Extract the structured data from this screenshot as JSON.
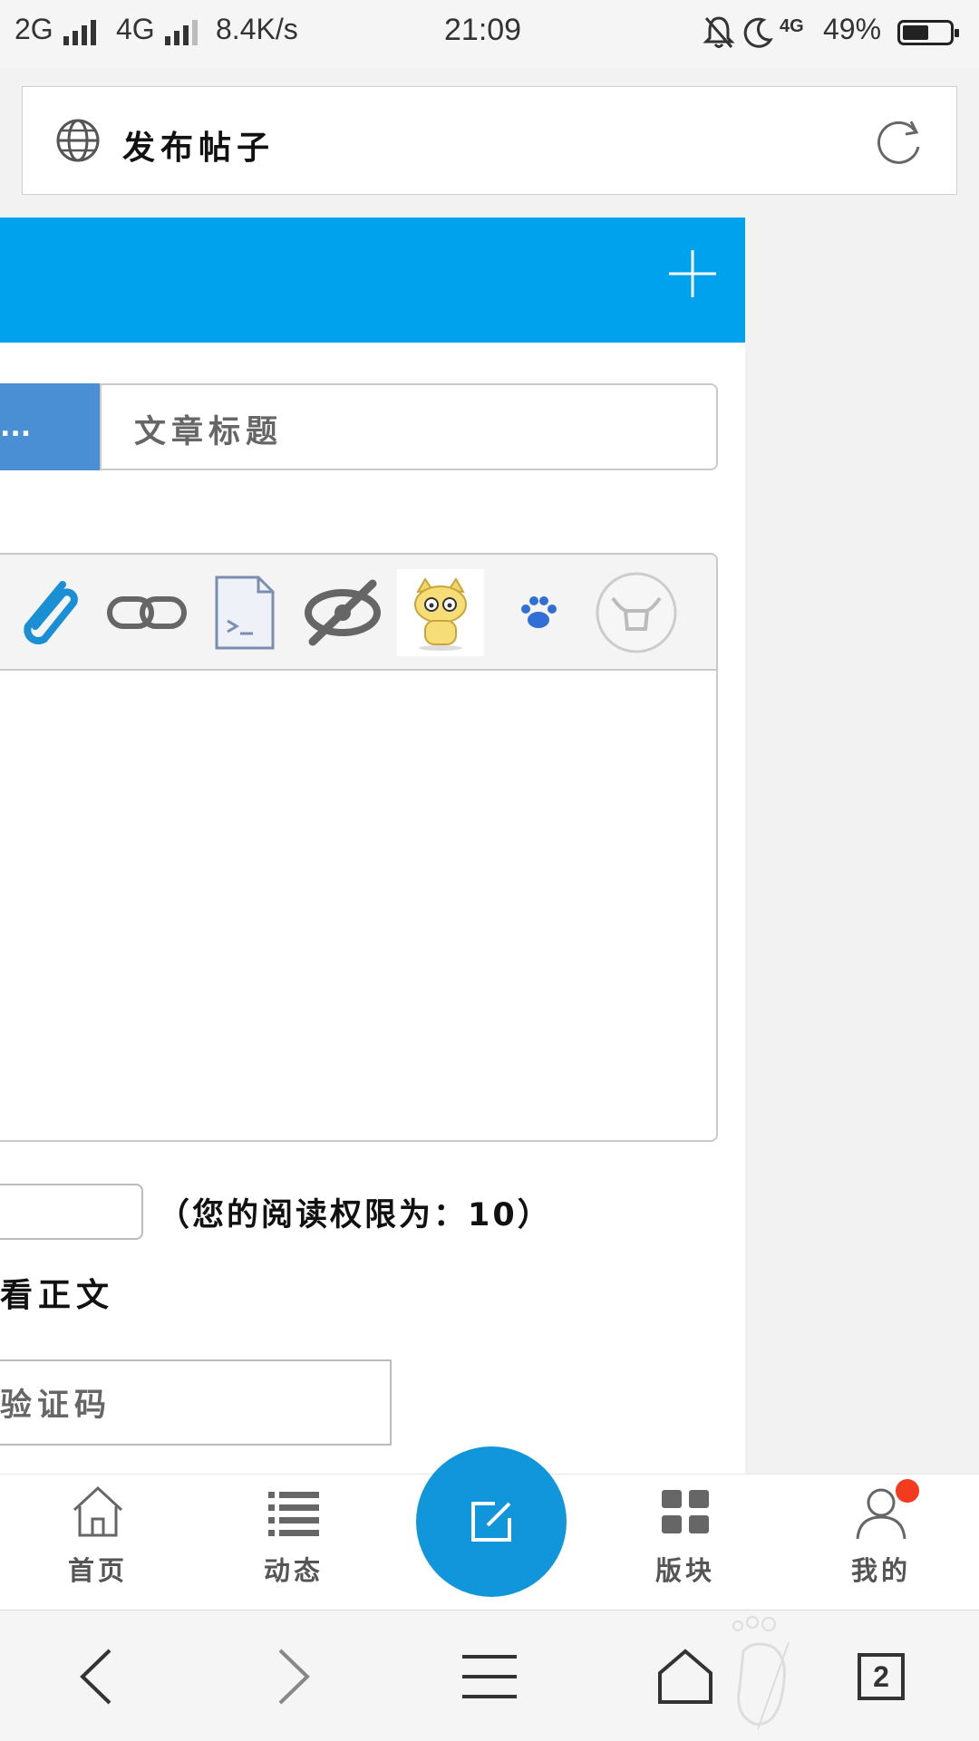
{
  "status_bar": {
    "network1": "2G",
    "network2": "4G",
    "speed": "8.4K/s",
    "time": "21:09",
    "lte": "4G",
    "battery": "49%",
    "battery_level": 0.49
  },
  "url_bar": {
    "title": "发布帖子",
    "globe_icon": "globe-icon",
    "reload_icon": "reload-icon"
  },
  "header": {
    "add_icon": "plus-icon",
    "accent": "#00a2ee"
  },
  "form": {
    "category_label": "...",
    "title_placeholder": "文章标题",
    "toolbar_icons": [
      "paperclip-icon",
      "link-icon",
      "code-icon",
      "hide-icon",
      "cat-emoji-icon",
      "paw-icon",
      "bull-icon"
    ],
    "permission_text": "（您的阅读权限为：10）",
    "view_text": "看正文",
    "captcha_placeholder": "验证码"
  },
  "tabbar": {
    "home": "首页",
    "feed": "动态",
    "boards": "版块",
    "me": "我的",
    "fab_icon": "edit-icon",
    "fab_color": "#1296db"
  },
  "browser_nav": {
    "tab_count": "2"
  }
}
